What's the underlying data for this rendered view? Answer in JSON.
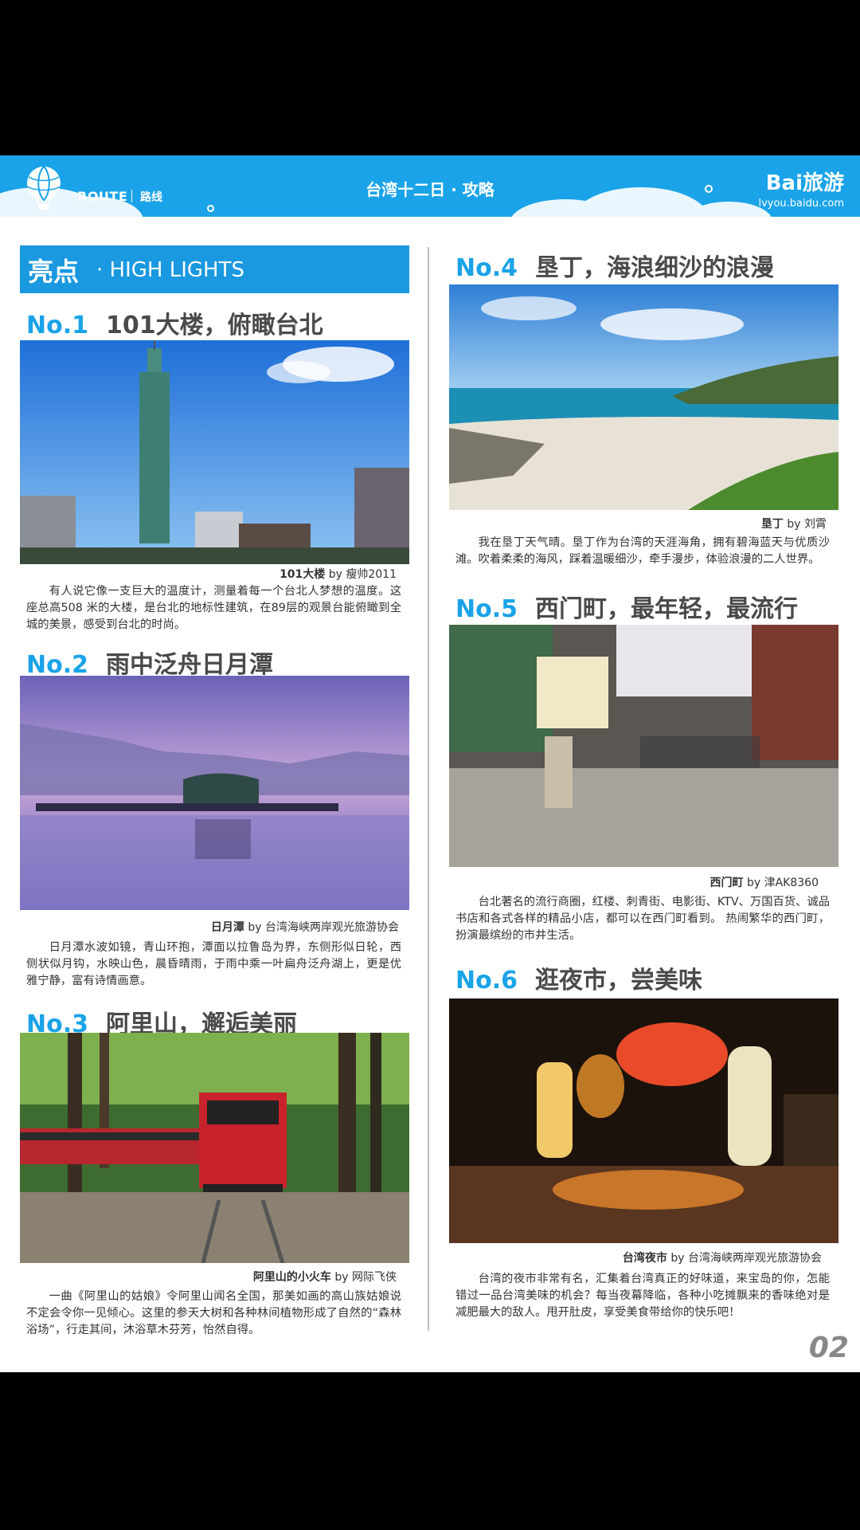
{
  "header": {
    "route_label": "ROUTE",
    "route_cn": "路线",
    "title": "台湾十二日 · 攻略",
    "brand_name": "Bai旅游",
    "brand_url": "lvyou.baidu.com"
  },
  "banner": {
    "cn": "亮点",
    "en": "· HIGH LIGHTS"
  },
  "colors": {
    "accent": "#1aa3e8",
    "banner": "#1a98e0",
    "heading": "#4a4a4a"
  },
  "sections": [
    {
      "no": "No.1",
      "title": "101大楼，俯瞰台北",
      "image": "taipei-101-photo",
      "credit_place": "101大楼",
      "credit_by": " by 瘦帅2011",
      "desc": "有人说它像一支巨大的温度计，测量着每一个台北人梦想的温度。这座总高508 米的大楼，是台北的地标性建筑，在89层的观景台能俯瞰到全城的美景，感受到台北的时尚。"
    },
    {
      "no": "No.2",
      "title": "雨中泛舟日月潭",
      "image": "sun-moon-lake-photo",
      "credit_place": "日月潭",
      "credit_by": " by 台湾海峡两岸观光旅游协会",
      "desc": "日月潭水波如镜，青山环抱，潭面以拉鲁岛为界，东侧形似日轮，西侧状似月钩，水映山色，晨昏晴雨，于雨中乘一叶扁舟泛舟湖上，更是优雅宁静，富有诗情画意。"
    },
    {
      "no": "No.3",
      "title": "阿里山，邂逅美丽",
      "image": "alishan-train-photo",
      "credit_place": "阿里山的小火车",
      "credit_by": " by 网际飞侠",
      "desc": "一曲《阿里山的姑娘》令阿里山闻名全国，那美如画的高山族姑娘说不定会令你一见倾心。这里的参天大树和各种林间植物形成了自然的“森林浴场”，行走其间，沐浴草木芬芳，怡然自得。"
    },
    {
      "no": "No.4",
      "title": "垦丁，海浪细沙的浪漫",
      "image": "kenting-beach-photo",
      "credit_place": "垦丁",
      "credit_by": " by 刘霄",
      "desc": "我在垦丁天气晴。垦丁作为台湾的天涯海角，拥有碧海蓝天与优质沙滩。吹着柔柔的海风，踩着温暖细沙，牵手漫步，体验浪漫的二人世界。"
    },
    {
      "no": "No.5",
      "title": "西门町，最年轻，最流行",
      "image": "ximending-street-photo",
      "credit_place": "西门町",
      "credit_by": " by 津AK8360",
      "desc": "台北著名的流行商圈，红楼、刺青街、电影街、KTV、万国百货、诚品书店和各式各样的精品小店，都可以在西门町看到。 热闹繁华的西门町，扮演最缤纷的市井生活。"
    },
    {
      "no": "No.6",
      "title": "逛夜市，尝美味",
      "image": "night-market-photo",
      "credit_place": "台湾夜市",
      "credit_by": " by 台湾海峡两岸观光旅游协会",
      "desc": "台湾的夜市非常有名，汇集着台湾真正的好味道，来宝岛的你，怎能错过一品台湾美味的机会？每当夜幕降临，各种小吃摊飘来的香味绝对是减肥最大的敌人。甩开肚皮，享受美食带给你的快乐吧！"
    }
  ],
  "page_number": "02"
}
